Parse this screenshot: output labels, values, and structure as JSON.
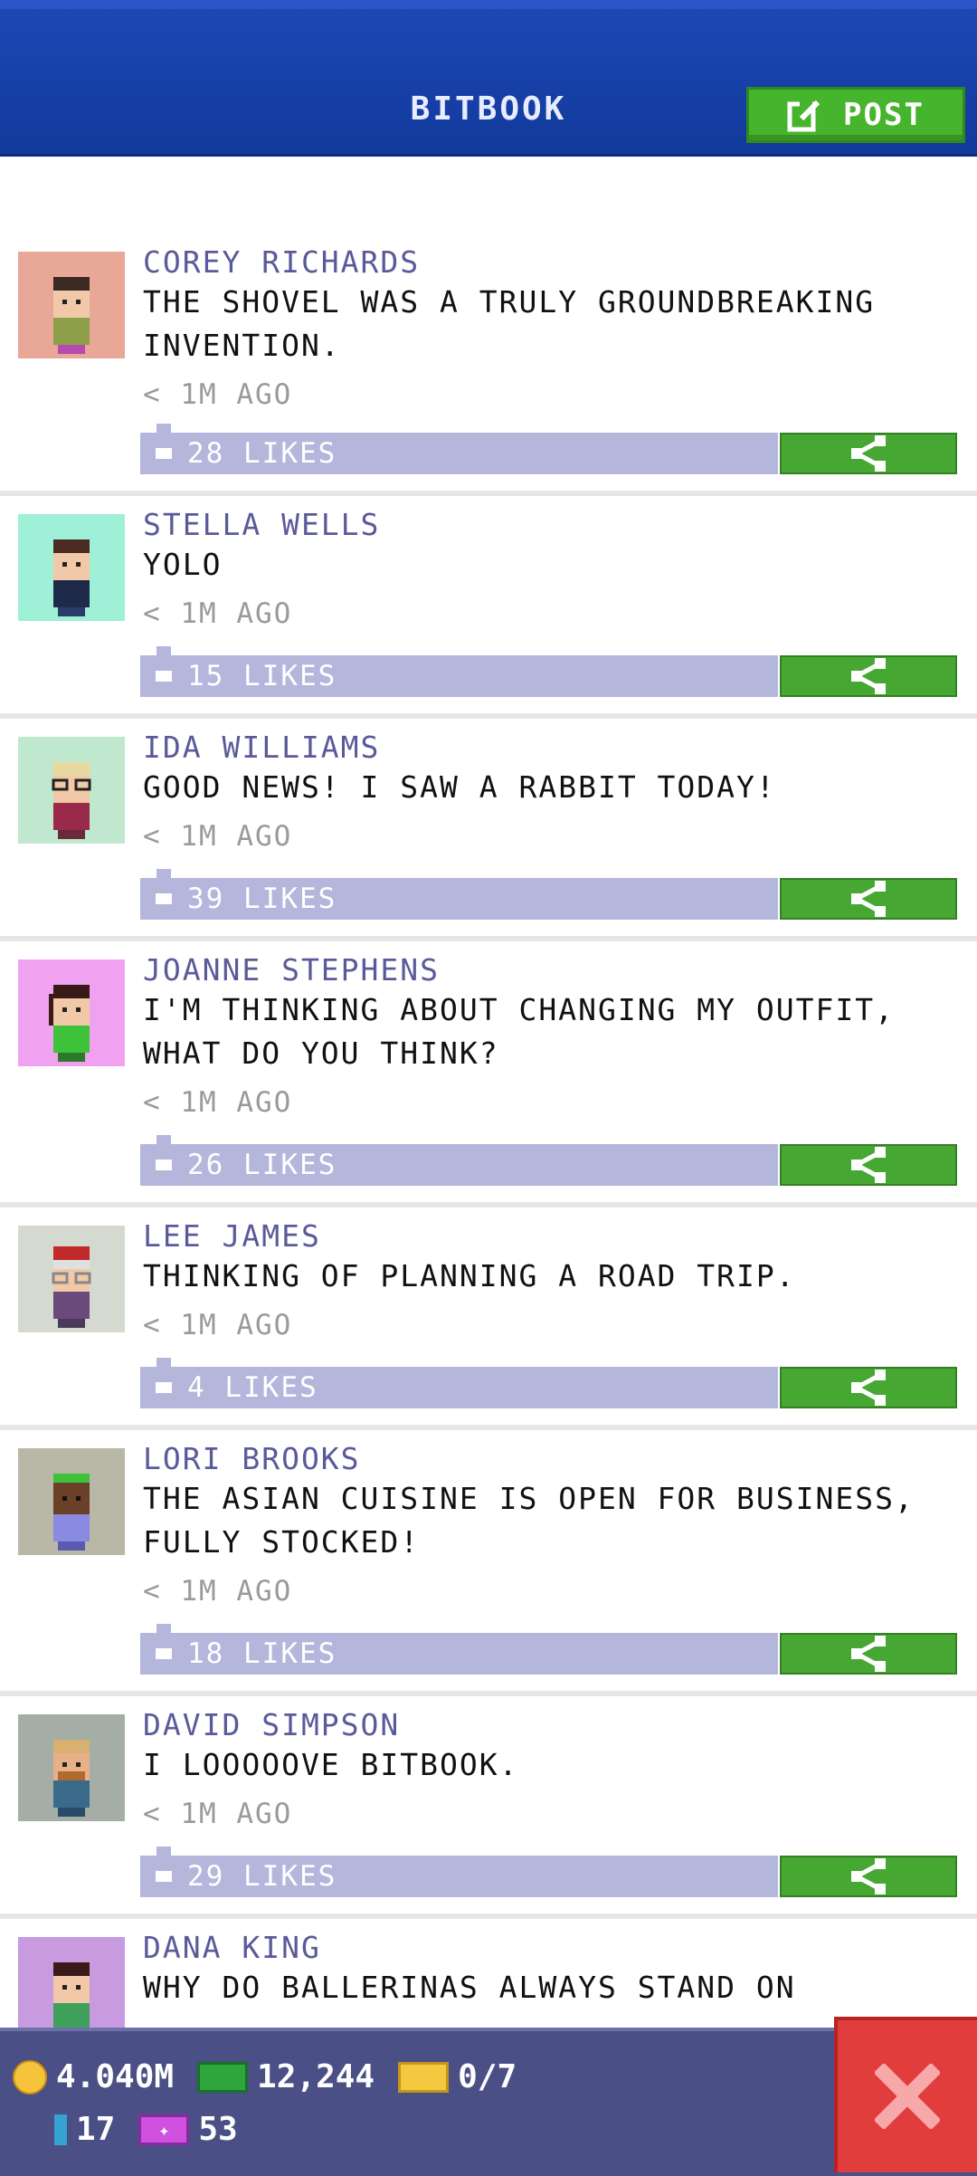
{
  "header": {
    "title": "BITBOOK",
    "post_label": "POST",
    "post_icon": "edit-icon"
  },
  "posts": [
    {
      "author": "COREY RICHARDS",
      "message": "THE SHOVEL WAS A TRULY GROUNDBREAKING INVENTION.",
      "time": "< 1M AGO",
      "likes": "28 LIKES",
      "avatar_color": "#e8a797"
    },
    {
      "author": "STELLA WELLS",
      "message": "YOLO",
      "time": "< 1M AGO",
      "likes": "15 LIKES",
      "avatar_color": "#9ef0d6"
    },
    {
      "author": "IDA WILLIAMS",
      "message": "GOOD NEWS! I SAW A RABBIT TODAY!",
      "time": "< 1M AGO",
      "likes": "39 LIKES",
      "avatar_color": "#bfe8cf"
    },
    {
      "author": "JOANNE STEPHENS",
      "message": "I'M THINKING ABOUT CHANGING MY OUTFIT, WHAT DO YOU THINK?",
      "time": "< 1M AGO",
      "likes": "26 LIKES",
      "avatar_color": "#f0a2f0"
    },
    {
      "author": "LEE JAMES",
      "message": "THINKING OF PLANNING A ROAD TRIP.",
      "time": "< 1M AGO",
      "likes": "4 LIKES",
      "avatar_color": "#d4dacf"
    },
    {
      "author": "LORI BROOKS",
      "message": "THE ASIAN CUISINE IS OPEN FOR BUSINESS, FULLY STOCKED!",
      "time": "< 1M AGO",
      "likes": "18 LIKES",
      "avatar_color": "#b9b8a6"
    },
    {
      "author": "DAVID SIMPSON",
      "message": "I LOOOOOVE BITBOOK.",
      "time": "< 1M AGO",
      "likes": "29 LIKES",
      "avatar_color": "#a5ada7"
    },
    {
      "author": "DANA KING",
      "message": "WHY DO BALLERINAS ALWAYS STAND ON",
      "time": "",
      "likes": "",
      "avatar_color": "#c89ae0"
    }
  ],
  "hud": {
    "coins": "4.040M",
    "bux": "12,244",
    "tickets": "0/7",
    "gems": "17",
    "vip": "53"
  },
  "colors": {
    "header_blue": "#1d47b4",
    "post_green": "#46b52d",
    "likes_bar": "#b4b6dc",
    "share_green": "#46a832",
    "author_purple": "#5a5a9a",
    "hud_bg": "#4a4f86",
    "close_red": "#e23d3d"
  },
  "icons": {
    "share": "share-icon",
    "like": "thumbs-up-icon",
    "close": "close-icon",
    "coin": "coin-icon",
    "bux": "bux-icon",
    "ticket": "ticket-icon",
    "gem": "gem-icon",
    "vip": "vip-icon"
  }
}
